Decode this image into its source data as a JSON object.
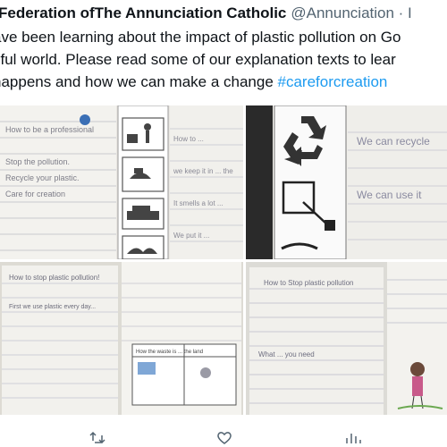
{
  "tweet": {
    "author_name": "Federation ofThe Annunciation Catholic",
    "author_handle": "@Annunciation · I",
    "text_lines": [
      "ave been learning about the impact of plastic pollution on Go",
      "tiful world. Please read some of our explanation texts to lear",
      " happens and how we can make a change "
    ],
    "hashtag": "#careforcreation"
  },
  "photos": [
    {
      "writing": [
        "How to be a professional",
        "Stop the pollution.",
        "Recycle your plastic.",
        "Care for creation"
      ],
      "strip_captions": [
        "How to ... ",
        "we keep it in ... the",
        "It smells a lot ... ",
        "We put it ... "
      ]
    },
    {
      "writing": [
        "We can recycle",
        "We can use it"
      ]
    },
    {
      "writing": [
        "How to stop plastic pollution!",
        "First we use plastic every day..."
      ],
      "table_header": "How the waste is ... the land"
    },
    {
      "writing": [
        "How to Stop plastic pollution",
        "What ... you need"
      ]
    }
  ],
  "actions": {
    "retweet_count": "",
    "like_count": "",
    "views_count": ""
  },
  "colors": {
    "text": "#0f1419",
    "secondary": "#536471",
    "link": "#1d9bf0"
  }
}
